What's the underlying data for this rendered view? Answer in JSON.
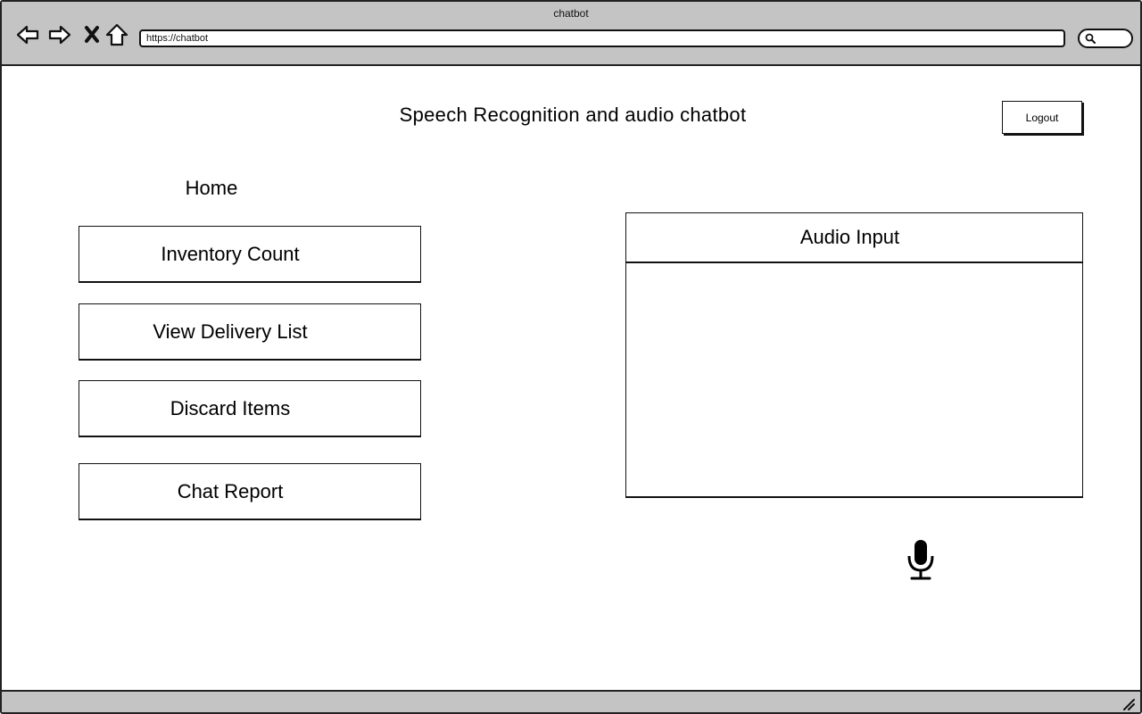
{
  "browser": {
    "title": "chatbot",
    "url": "https://chatbot"
  },
  "header": {
    "title": "Speech Recognition and audio chatbot",
    "logout_label": "Logout"
  },
  "nav": {
    "home_label": "Home",
    "items": [
      {
        "label": "Inventory Count"
      },
      {
        "label": "View Delivery List"
      },
      {
        "label": "Discard Items"
      },
      {
        "label": "Chat Report"
      }
    ]
  },
  "audio": {
    "panel_title": "Audio Input",
    "mic_icon": "microphone-icon"
  }
}
